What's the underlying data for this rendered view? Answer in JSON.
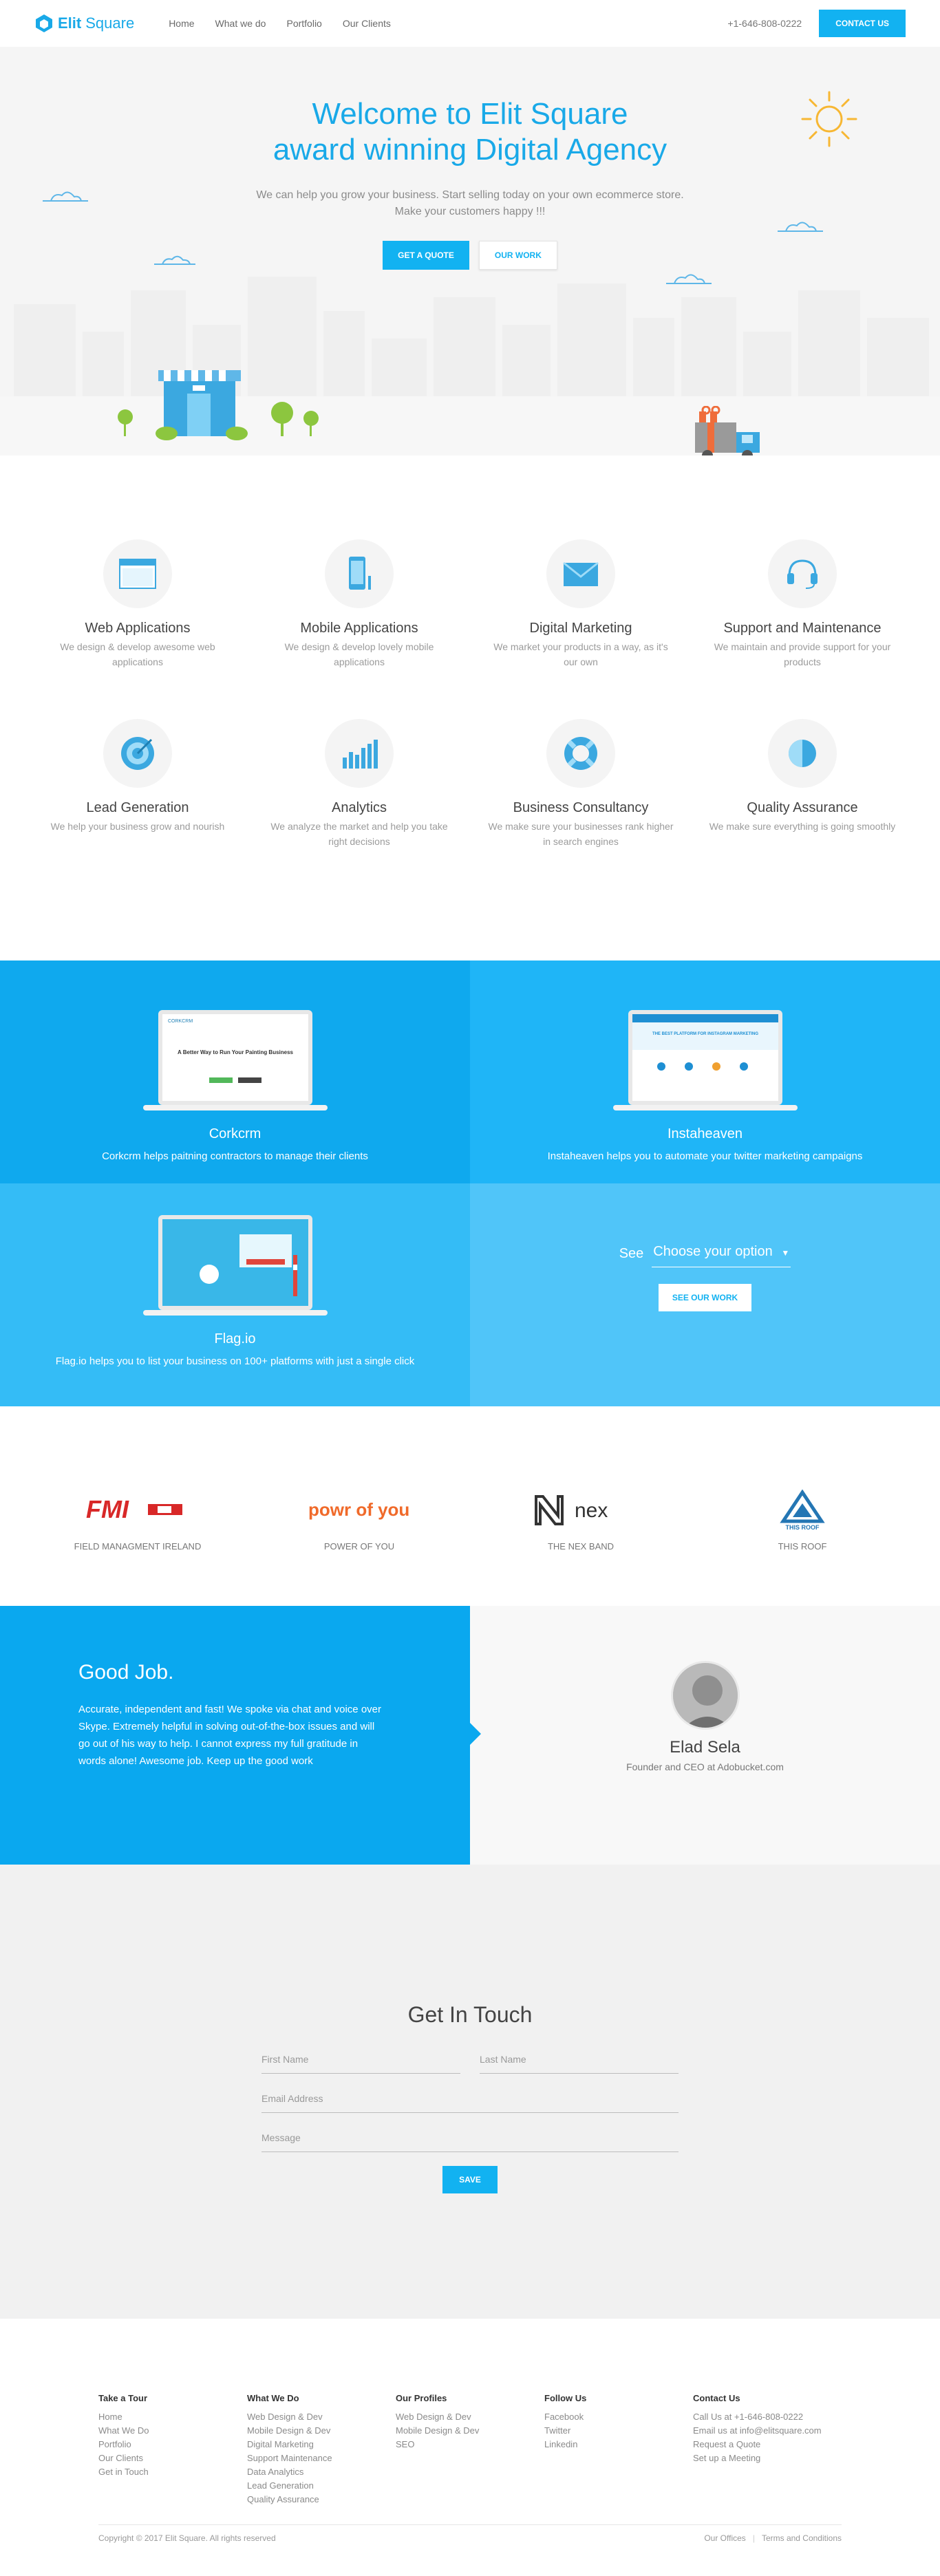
{
  "nav": {
    "brand_prefix": "Elit",
    "brand_suffix": "Square",
    "links": [
      "Home",
      "What we do",
      "Portfolio",
      "Our Clients"
    ],
    "phone": "+1-646-808-0222",
    "cta": "CONTACT US"
  },
  "hero": {
    "title_line1": "Welcome to Elit Square",
    "title_line2": "award winning Digital Agency",
    "subtitle": "We can help you grow your business. Start selling today on your own ecommerce store. Make your customers happy !!!",
    "btn_quote": "GET A QUOTE",
    "btn_work": "OUR WORK"
  },
  "services": [
    {
      "title": "Web Applications",
      "desc": "We design & develop awesome web applications",
      "icon": "browser-window-icon"
    },
    {
      "title": "Mobile Applications",
      "desc": "We design & develop lovely mobile applications",
      "icon": "mobile-phone-icon"
    },
    {
      "title": "Digital Marketing",
      "desc": "We market your products in a way, as it's our own",
      "icon": "envelope-icon"
    },
    {
      "title": "Support and Maintenance",
      "desc": "We maintain and provide support for your products",
      "icon": "headset-icon"
    },
    {
      "title": "Lead Generation",
      "desc": "We help your business grow and nourish",
      "icon": "target-icon"
    },
    {
      "title": "Analytics",
      "desc": "We analyze the market and help you take right decisions",
      "icon": "bar-chart-icon"
    },
    {
      "title": "Business Consultancy",
      "desc": "We make sure your businesses rank higher in search engines",
      "icon": "lifebuoy-icon"
    },
    {
      "title": "Quality Assurance",
      "desc": "We make sure everything is going smoothly",
      "icon": "half-circle-icon"
    }
  ],
  "portfolio": {
    "items": [
      {
        "title": "Corkcrm",
        "desc": "Corkcrm helps paitning contractors to manage their clients"
      },
      {
        "title": "Instaheaven",
        "desc": "Instaheaven helps you to automate your twitter marketing campaigns"
      },
      {
        "title": "Flag.io",
        "desc": "Flag.io helps you to list your business on 100+ platforms with just a single click"
      }
    ],
    "corkcrm_screen_heading": "A Better Way to Run Your Painting Business",
    "corkcrm_logo": "CORKCRM",
    "insta_screen_heading": "THE BEST PLATFORM FOR INSTAGRAM MARKETING",
    "see_label": "See",
    "select_value": "Choose your option",
    "see_btn": "SEE OUR WORK"
  },
  "clients": [
    {
      "name": "FIELD MANAGMENT IRELAND",
      "logo": "FMI"
    },
    {
      "name": "POWER OF YOU",
      "logo": "powr of you"
    },
    {
      "name": "THE NEX BAND",
      "logo": "nex"
    },
    {
      "name": "THIS ROOF",
      "logo": "THIS ROOF"
    }
  ],
  "testimonial": {
    "heading": "Good Job.",
    "quote": "Accurate, independent and fast! We spoke via chat and voice over Skype. Extremely helpful in solving out-of-the-box issues and will go out of his way to help. I cannot express my full gratitude in words alone! Awesome job. Keep up the good work",
    "name": "Elad Sela",
    "role": "Founder and CEO at Adobucket.com"
  },
  "contact": {
    "title": "Get In Touch",
    "first_name": "First Name",
    "last_name": "Last Name",
    "email": "Email Address",
    "message": "Message",
    "save": "SAVE"
  },
  "footer": {
    "cols": [
      {
        "title": "Take a Tour",
        "links": [
          "Home",
          "What We Do",
          "Portfolio",
          "Our Clients",
          "Get in Touch"
        ]
      },
      {
        "title": "What We Do",
        "links": [
          "Web Design & Dev",
          "Mobile Design & Dev",
          "Digital Marketing",
          "Support Maintenance",
          "Data Analytics",
          "Lead Generation",
          "Quality Assurance"
        ]
      },
      {
        "title": "Our Profiles",
        "links": [
          "Web Design & Dev",
          "Mobile Design & Dev",
          "SEO"
        ]
      },
      {
        "title": "Follow Us",
        "links": [
          "Facebook",
          "Twitter",
          "Linkedin"
        ]
      },
      {
        "title": "Contact Us",
        "links": [
          "Call Us at +1-646-808-0222",
          "Email us at info@elitsquare.com",
          "Request a Quote",
          "Set up a Meeting"
        ]
      }
    ],
    "copyright": "Copyright © 2017 Elit Square. All rights reserved",
    "offices": "Our Offices",
    "terms": "Terms and Conditions"
  },
  "colors": {
    "accent": "#12b2f1",
    "accent_dark": "#0aa8ef"
  }
}
